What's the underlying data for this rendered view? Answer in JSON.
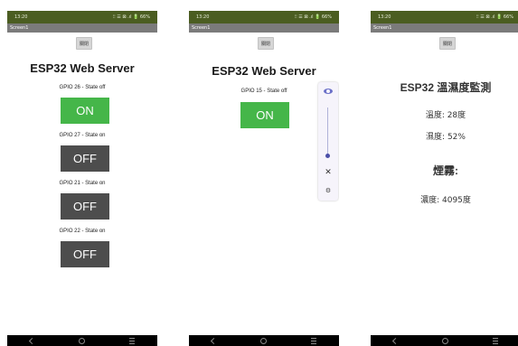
{
  "status": {
    "time": "13:20",
    "icons": "⁝⁝ ☰ ⊠ .ıl 🔋 66%"
  },
  "screen_title": "Screen1",
  "top_button_label": "關閉",
  "phone1": {
    "heading": "ESP32 Web Server",
    "gpios": [
      {
        "label": "GPIO 26 - State off",
        "button": "ON"
      },
      {
        "label": "GPIO 27 - State on",
        "button": "OFF"
      },
      {
        "label": "GPIO 21 - State on",
        "button": "OFF"
      },
      {
        "label": "GPIO 22 - State on",
        "button": "OFF"
      }
    ]
  },
  "phone2": {
    "heading": "ESP32 Web Server",
    "gpio": {
      "label": "GPIO 15 - State off",
      "button": "ON"
    },
    "panel": {
      "mute_glyph": "✕",
      "settings_glyph": "⚙"
    }
  },
  "phone3": {
    "heading": "ESP32 溫濕度監測",
    "temperature": "溫度: 28度",
    "humidity": "濕度: 52%",
    "smoke_heading": "煙霧:",
    "concentration": "濃度: 4095度"
  },
  "nav": {
    "back": "‹",
    "home": "○",
    "recents": "≡"
  }
}
